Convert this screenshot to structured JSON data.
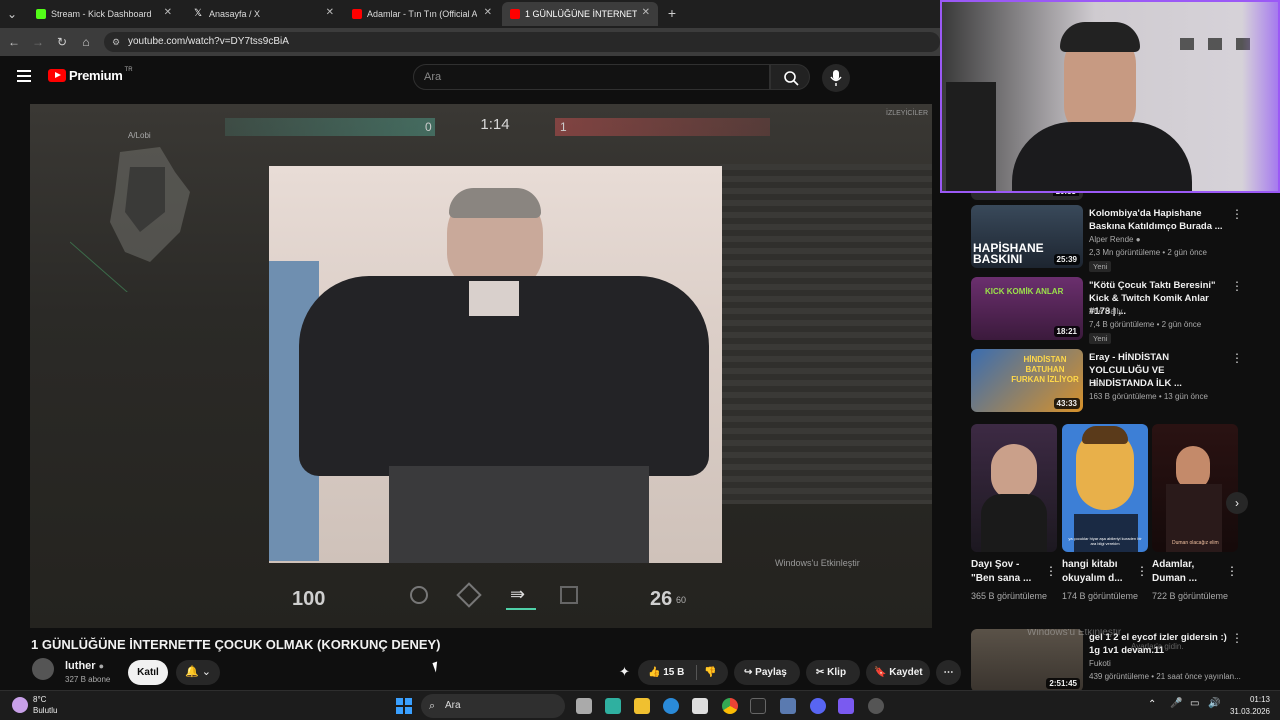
{
  "browser": {
    "tabs": [
      {
        "label": "Stream - Kick Dashboard",
        "icon": "kick-icon",
        "color": "#53fc18"
      },
      {
        "label": "Anasayfa / X",
        "icon": "x-icon",
        "color": "#ffffff"
      },
      {
        "label": "Adamlar - Tın Tın (Official Audi",
        "icon": "youtube-icon",
        "color": "#ff0000"
      },
      {
        "label": "1 GÜNLÜĞÜNE İNTERNETTE ÇO",
        "icon": "youtube-icon",
        "color": "#ff0000"
      }
    ],
    "url": "youtube.com/watch?v=DY7tss9cBiA"
  },
  "youtube": {
    "logo_text": "Premium",
    "logo_region": "TR",
    "search_placeholder": "Ara"
  },
  "video": {
    "game_hud": {
      "map_label": "A/Lobi",
      "timer": "1:14",
      "left_score": "0",
      "right_score": "1",
      "health": "100",
      "ammo": "26",
      "reserve": "60",
      "spectators": "İZLEYİCİLER",
      "windows_watermark": "Windows'u Etkinleştir"
    },
    "title": "1 GÜNLÜĞÜNE İNTERNETTE ÇOCUK OLMAK (KORKUNÇ DENEY)",
    "channel": {
      "name": "luther",
      "subs": "327 B abone"
    },
    "join_label": "Katıl",
    "likes": "15 B",
    "share_label": "Paylaş",
    "clip_label": "Klip",
    "save_label": "Kaydet"
  },
  "sidebar": {
    "top_partial_duration": "10:53",
    "recs": [
      {
        "title": "Kolombiya'da Hapishane Baskına Katıldımc̦o Burada ...",
        "channel": "Alper Rende",
        "meta": "2,3 Mn görüntüleme • 2 gün önce",
        "badge": "Yeni",
        "duration": "25:39",
        "thumb_text": "HAPİSHANE BASKINI"
      },
      {
        "title": "\"Kötü Çocuk Taktı Beresini\" Kick & Twitch Komik Anlar #178 | ...",
        "channel": "The Pally",
        "meta": "7,4 B görüntüleme • 2 gün önce",
        "badge": "Yeni",
        "duration": "18:21",
        "thumb_text": "KICK KOMİK ANLAR"
      },
      {
        "title": "Eray - HİNDİSTAN YOLCULUĞU VE HİNDİSTANDA İLK ...",
        "channel": "Cilet",
        "meta": "163 B görüntüleme • 13 gün önce",
        "badge": "",
        "duration": "43:33",
        "thumb_text": "HİNDİSTAN BATUHAN FURKAN İZLİYOR"
      }
    ],
    "shorts": [
      {
        "title": "Dayı Şov - \"Ben sana ...",
        "views": "365 B görüntüleme"
      },
      {
        "title": "hangi kitabı okuyalım d...",
        "views": "174 B görüntüleme",
        "caption": "ya çocuklar hiyar aşa abileriyi kuraden bir ara bilgi vereklm"
      },
      {
        "title": "Adamlar, Duman ...",
        "views": "722 B görüntüleme",
        "caption": "Duman olacağız elim"
      }
    ],
    "bottom_rec": {
      "title": "gel 1 2 el eycof izler gidersin :) 1g 1v1 devam.11",
      "channel": "Fukoti",
      "meta": "439 görüntüleme • 21 saat önce yayınlan...",
      "duration": "2:51:45",
      "overlay": "Windows'u Etkinleştir",
      "overlay2": "Ayarlar'a gidin."
    }
  },
  "taskbar": {
    "weather_temp": "8°C",
    "weather_desc": "Bulutlu",
    "search": "Ara",
    "time": "01:13",
    "date": "31.03.2026"
  }
}
